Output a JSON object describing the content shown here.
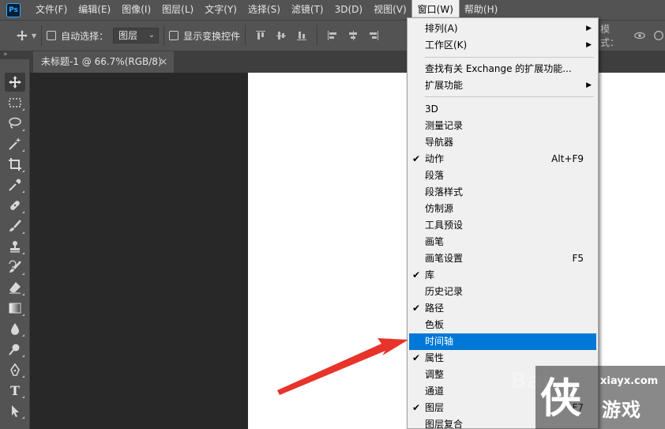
{
  "app": {
    "logo": "Ps"
  },
  "menubar": {
    "items": [
      {
        "label": "文件(F)"
      },
      {
        "label": "编辑(E)"
      },
      {
        "label": "图像(I)"
      },
      {
        "label": "图层(L)"
      },
      {
        "label": "文字(Y)"
      },
      {
        "label": "选择(S)"
      },
      {
        "label": "滤镜(T)"
      },
      {
        "label": "3D(D)"
      },
      {
        "label": "视图(V)"
      },
      {
        "label": "窗口(W)",
        "active": true
      },
      {
        "label": "帮助(H)"
      }
    ]
  },
  "options_bar": {
    "auto_select_label": "自动选择：",
    "auto_select_checked": false,
    "auto_select_target": "图层",
    "show_transform_label": "显示变换控件",
    "show_transform_checked": false,
    "mode_label": "模式："
  },
  "document": {
    "tab_title": "未标题-1 @ 66.7%(RGB/8)",
    "close_glyph": "×"
  },
  "toolbar": {
    "collapse_glyph": "»",
    "tools": [
      {
        "name": "move-tool-icon",
        "selected": true
      },
      {
        "name": "marquee-tool-icon"
      },
      {
        "name": "lasso-tool-icon"
      },
      {
        "name": "magic-wand-tool-icon"
      },
      {
        "name": "crop-tool-icon"
      },
      {
        "name": "eyedropper-tool-icon"
      },
      {
        "name": "healing-brush-tool-icon"
      },
      {
        "name": "brush-tool-icon"
      },
      {
        "name": "clone-stamp-tool-icon"
      },
      {
        "name": "history-brush-tool-icon"
      },
      {
        "name": "eraser-tool-icon"
      },
      {
        "name": "gradient-tool-icon"
      },
      {
        "name": "blur-tool-icon"
      },
      {
        "name": "dodge-tool-icon"
      },
      {
        "name": "pen-tool-icon"
      },
      {
        "name": "type-tool-icon",
        "glyph": "T"
      },
      {
        "name": "path-selection-tool-icon"
      }
    ]
  },
  "window_menu": {
    "items": [
      {
        "label": "排列(A)",
        "submenu": true
      },
      {
        "label": "工作区(K)",
        "submenu": true
      },
      {
        "separator": true
      },
      {
        "label": "查找有关 Exchange 的扩展功能..."
      },
      {
        "label": "扩展功能",
        "submenu": true
      },
      {
        "separator": true
      },
      {
        "label": "3D"
      },
      {
        "label": "测量记录"
      },
      {
        "label": "导航器"
      },
      {
        "label": "动作",
        "checked": true,
        "shortcut": "Alt+F9"
      },
      {
        "label": "段落"
      },
      {
        "label": "段落样式"
      },
      {
        "label": "仿制源"
      },
      {
        "label": "工具预设"
      },
      {
        "label": "画笔"
      },
      {
        "label": "画笔设置",
        "shortcut": "F5"
      },
      {
        "label": "库",
        "checked": true
      },
      {
        "label": "历史记录"
      },
      {
        "label": "路径",
        "checked": true
      },
      {
        "label": "色板"
      },
      {
        "label": "时间轴",
        "highlighted": true
      },
      {
        "label": "属性",
        "checked": true
      },
      {
        "label": "调整"
      },
      {
        "label": "通道"
      },
      {
        "label": "图层",
        "checked": true,
        "shortcut": "F7"
      },
      {
        "label": "图层复合"
      }
    ]
  },
  "annotation": {
    "arrow_color": "#e8332a"
  },
  "watermark": {
    "site": "xiayx.com",
    "brand": "游戏",
    "glyph": "侠",
    "faint_text": "Bai"
  },
  "colors": {
    "highlight": "#0078d7",
    "menu_bg": "#f0f0f0",
    "ui_bg": "#535353",
    "workspace_bg": "#282828"
  }
}
